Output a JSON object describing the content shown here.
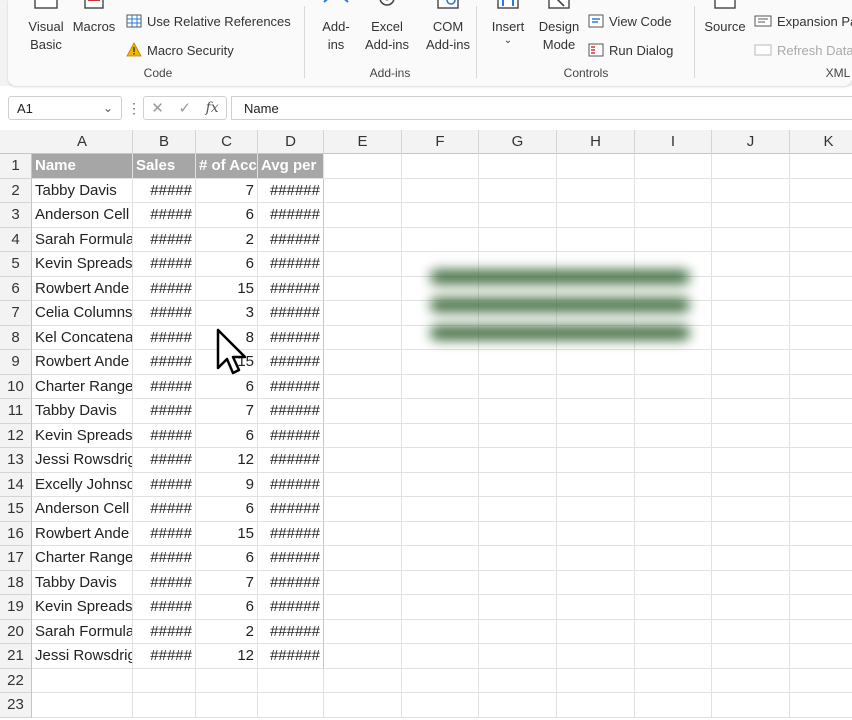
{
  "ribbon": {
    "code": {
      "visual_basic": "Visual\nBasic",
      "macros": "Macros",
      "relative_refs": "Use Relative References",
      "macro_security": "Macro Security",
      "label": "Code"
    },
    "addins": {
      "addins": "Add-\nins",
      "excel_addins": "Excel\nAdd-ins",
      "com_addins": "COM\nAdd-ins",
      "label": "Add-ins"
    },
    "controls": {
      "insert": "Insert",
      "design_mode": "Design\nMode",
      "view_code": "View Code",
      "run_dialog": "Run Dialog",
      "label": "Controls"
    },
    "xml": {
      "source": "Source",
      "expansion_packs": "Expansion Pa",
      "refresh_data": "Refresh Data",
      "label": "XML"
    }
  },
  "formula_bar": {
    "name_box": "A1",
    "formula": "Name"
  },
  "columns": [
    "A",
    "B",
    "C",
    "D",
    "E",
    "F",
    "G",
    "H",
    "I",
    "J",
    "K"
  ],
  "row_numbers": [
    "1",
    "2",
    "3",
    "4",
    "5",
    "6",
    "7",
    "8",
    "9",
    "10",
    "11",
    "12",
    "13",
    "14",
    "15",
    "16",
    "17",
    "18",
    "19",
    "20",
    "21",
    "22",
    "23"
  ],
  "table": {
    "headers": [
      "Name",
      "Sales",
      "# of Acc",
      "Avg per"
    ],
    "rows": [
      [
        "Tabby Davis",
        "#####",
        "7",
        "######"
      ],
      [
        "Anderson Cell",
        "#####",
        "6",
        "######"
      ],
      [
        "Sarah Formula",
        "#####",
        "2",
        "######"
      ],
      [
        "Kevin Spreads",
        "#####",
        "6",
        "######"
      ],
      [
        "Rowbert Ande",
        "#####",
        "15",
        "######"
      ],
      [
        "Celia Columns",
        "#####",
        "3",
        "######"
      ],
      [
        "Kel Concatena",
        "#####",
        "8",
        "######"
      ],
      [
        "Rowbert Ande",
        "#####",
        "15",
        "######"
      ],
      [
        "Charter Range",
        "#####",
        "6",
        "######"
      ],
      [
        "Tabby Davis",
        "#####",
        "7",
        "######"
      ],
      [
        "Kevin Spreads",
        "#####",
        "6",
        "######"
      ],
      [
        "Jessi Rowsdrig",
        "#####",
        "12",
        "######"
      ],
      [
        "Excelly Johnso",
        "#####",
        "9",
        "######"
      ],
      [
        "Anderson Cell",
        "#####",
        "6",
        "######"
      ],
      [
        "Rowbert Ande",
        "#####",
        "15",
        "######"
      ],
      [
        "Charter Range",
        "#####",
        "6",
        "######"
      ],
      [
        "Tabby Davis",
        "#####",
        "7",
        "######"
      ],
      [
        "Kevin Spreads",
        "#####",
        "6",
        "######"
      ],
      [
        "Sarah Formula",
        "#####",
        "2",
        "######"
      ],
      [
        "Jessi Rowsdrig",
        "#####",
        "12",
        "######"
      ]
    ]
  },
  "colors": {
    "header_fill": "#a6a6a6",
    "ribbon_bg": "#fafafa"
  }
}
